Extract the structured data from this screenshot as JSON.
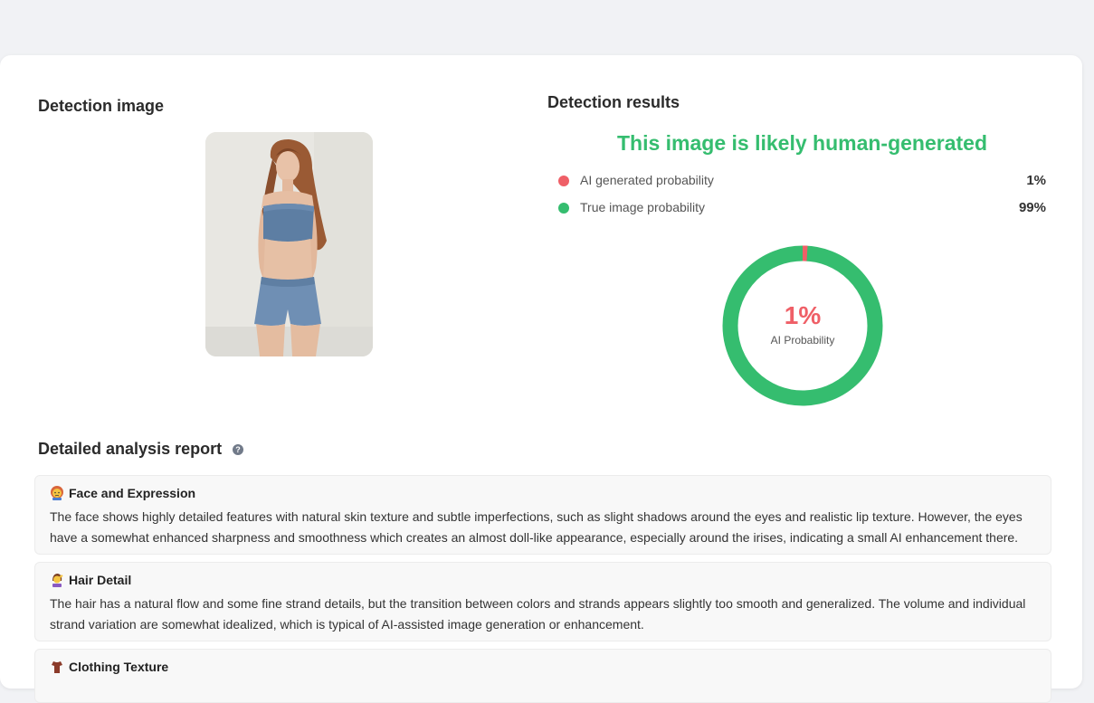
{
  "detection_image": {
    "title": "Detection image"
  },
  "detection_results": {
    "title": "Detection results",
    "verdict": "This image is likely human-generated",
    "ai_probability": {
      "label": "AI generated probability",
      "value": "1%",
      "color": "#ef5f67"
    },
    "true_probability": {
      "label": "True image probability",
      "value": "99%",
      "color": "#35bd6f"
    },
    "donut": {
      "ai_fraction": 0.01,
      "center_value": "1%",
      "center_label": "AI Probability"
    }
  },
  "report": {
    "title": "Detailed analysis report",
    "help_glyph": "?",
    "sections": [
      {
        "icon": "person-pouting-emoji-icon",
        "title": "Face and Expression",
        "body": "The face shows highly detailed features with natural skin texture and subtle imperfections, such as slight shadows around the eyes and realistic lip texture. However, the eyes have a somewhat enhanced sharpness and smoothness which creates an almost doll-like appearance, especially around the irises, indicating a small AI enhancement there."
      },
      {
        "icon": "person-hair-emoji-icon",
        "title": "Hair Detail",
        "body": "The hair has a natural flow and some fine strand details, but the transition between colors and strands appears slightly too smooth and generalized. The volume and individual strand variation are somewhat idealized, which is typical of AI-assisted image generation or enhancement."
      },
      {
        "icon": "clothing-emoji-icon",
        "title": "Clothing Texture",
        "body": ""
      }
    ]
  }
}
